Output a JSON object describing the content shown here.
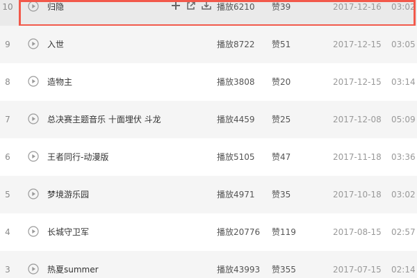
{
  "colors": {
    "highlight_border": "#f2594b",
    "row_alt_bg": "#f5f5f5",
    "row_active_bg": "#eaeaea",
    "text_primary": "#333333",
    "text_secondary": "#999999"
  },
  "tracks": [
    {
      "num": "10",
      "title": "归隐",
      "plays": "播放6210",
      "likes": "赞39",
      "date": "2017-12-16",
      "duration": "03:02"
    },
    {
      "num": "9",
      "title": "入世",
      "plays": "播放8722",
      "likes": "赞51",
      "date": "2017-12-15",
      "duration": "03:05"
    },
    {
      "num": "8",
      "title": "造物主",
      "plays": "播放3808",
      "likes": "赞20",
      "date": "2017-12-15",
      "duration": "03:14"
    },
    {
      "num": "7",
      "title": "总决赛主题音乐 十面埋伏 斗龙",
      "plays": "播放4459",
      "likes": "赞25",
      "date": "2017-12-08",
      "duration": "05:09"
    },
    {
      "num": "6",
      "title": "王者同行-动漫版",
      "plays": "播放5105",
      "likes": "赞47",
      "date": "2017-11-18",
      "duration": "03:36"
    },
    {
      "num": "5",
      "title": "梦境游乐园",
      "plays": "播放4971",
      "likes": "赞35",
      "date": "2017-10-18",
      "duration": "03:02"
    },
    {
      "num": "4",
      "title": "长城守卫军",
      "plays": "播放20776",
      "likes": "赞119",
      "date": "2017-08-15",
      "duration": "02:57"
    },
    {
      "num": "3",
      "title": "热夏summer",
      "plays": "播放43993",
      "likes": "赞355",
      "date": "2017-07-15",
      "duration": "02:14"
    }
  ],
  "active_row_actions": [
    "add-icon",
    "share-icon",
    "download-icon"
  ]
}
